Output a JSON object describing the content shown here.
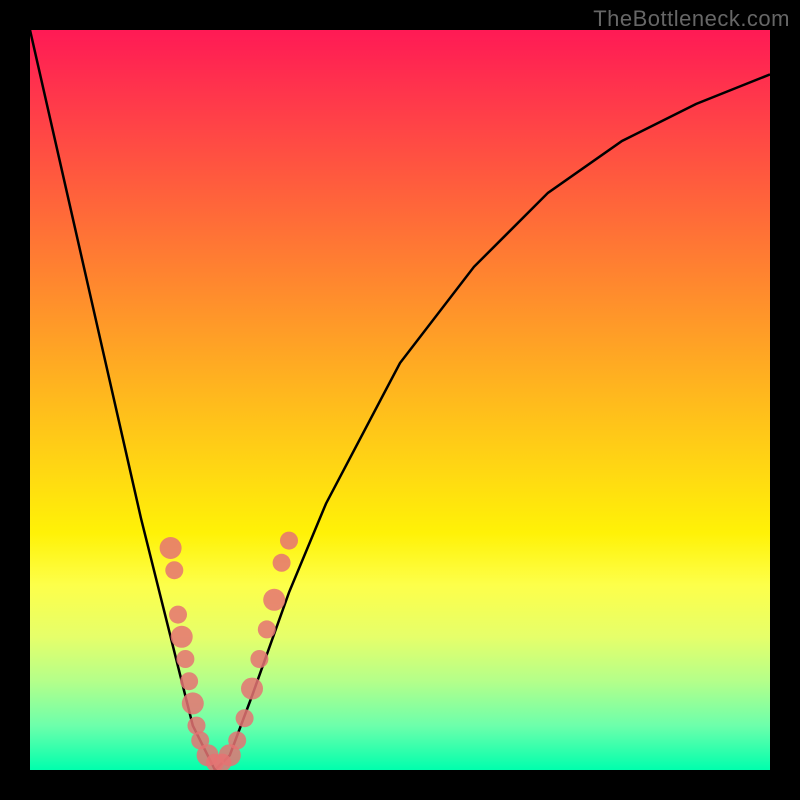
{
  "watermark": "TheBottleneck.com",
  "chart_data": {
    "type": "line",
    "title": "",
    "xlabel": "",
    "ylabel": "",
    "xlim": [
      0,
      100
    ],
    "ylim": [
      0,
      100
    ],
    "background_gradient": [
      "#ff1a55",
      "#ff9a28",
      "#fff207",
      "#00ffad"
    ],
    "series": [
      {
        "name": "bottleneck-curve",
        "x": [
          0,
          5,
          10,
          15,
          18,
          20,
          22,
          24,
          25,
          27,
          30,
          35,
          40,
          50,
          60,
          70,
          80,
          90,
          100
        ],
        "values": [
          100,
          78,
          56,
          34,
          22,
          14,
          6,
          2,
          0,
          2,
          10,
          24,
          36,
          55,
          68,
          78,
          85,
          90,
          94
        ]
      }
    ],
    "markers": {
      "name": "data-points",
      "color": "#e57373",
      "points": [
        {
          "x": 19,
          "y": 30
        },
        {
          "x": 19.5,
          "y": 27
        },
        {
          "x": 20,
          "y": 21
        },
        {
          "x": 20.5,
          "y": 18
        },
        {
          "x": 21,
          "y": 15
        },
        {
          "x": 21.5,
          "y": 12
        },
        {
          "x": 22,
          "y": 9
        },
        {
          "x": 22.5,
          "y": 6
        },
        {
          "x": 23,
          "y": 4
        },
        {
          "x": 24,
          "y": 2
        },
        {
          "x": 25,
          "y": 1
        },
        {
          "x": 26,
          "y": 1
        },
        {
          "x": 27,
          "y": 2
        },
        {
          "x": 28,
          "y": 4
        },
        {
          "x": 29,
          "y": 7
        },
        {
          "x": 30,
          "y": 11
        },
        {
          "x": 31,
          "y": 15
        },
        {
          "x": 32,
          "y": 19
        },
        {
          "x": 33,
          "y": 23
        },
        {
          "x": 34,
          "y": 28
        },
        {
          "x": 35,
          "y": 31
        }
      ]
    }
  }
}
